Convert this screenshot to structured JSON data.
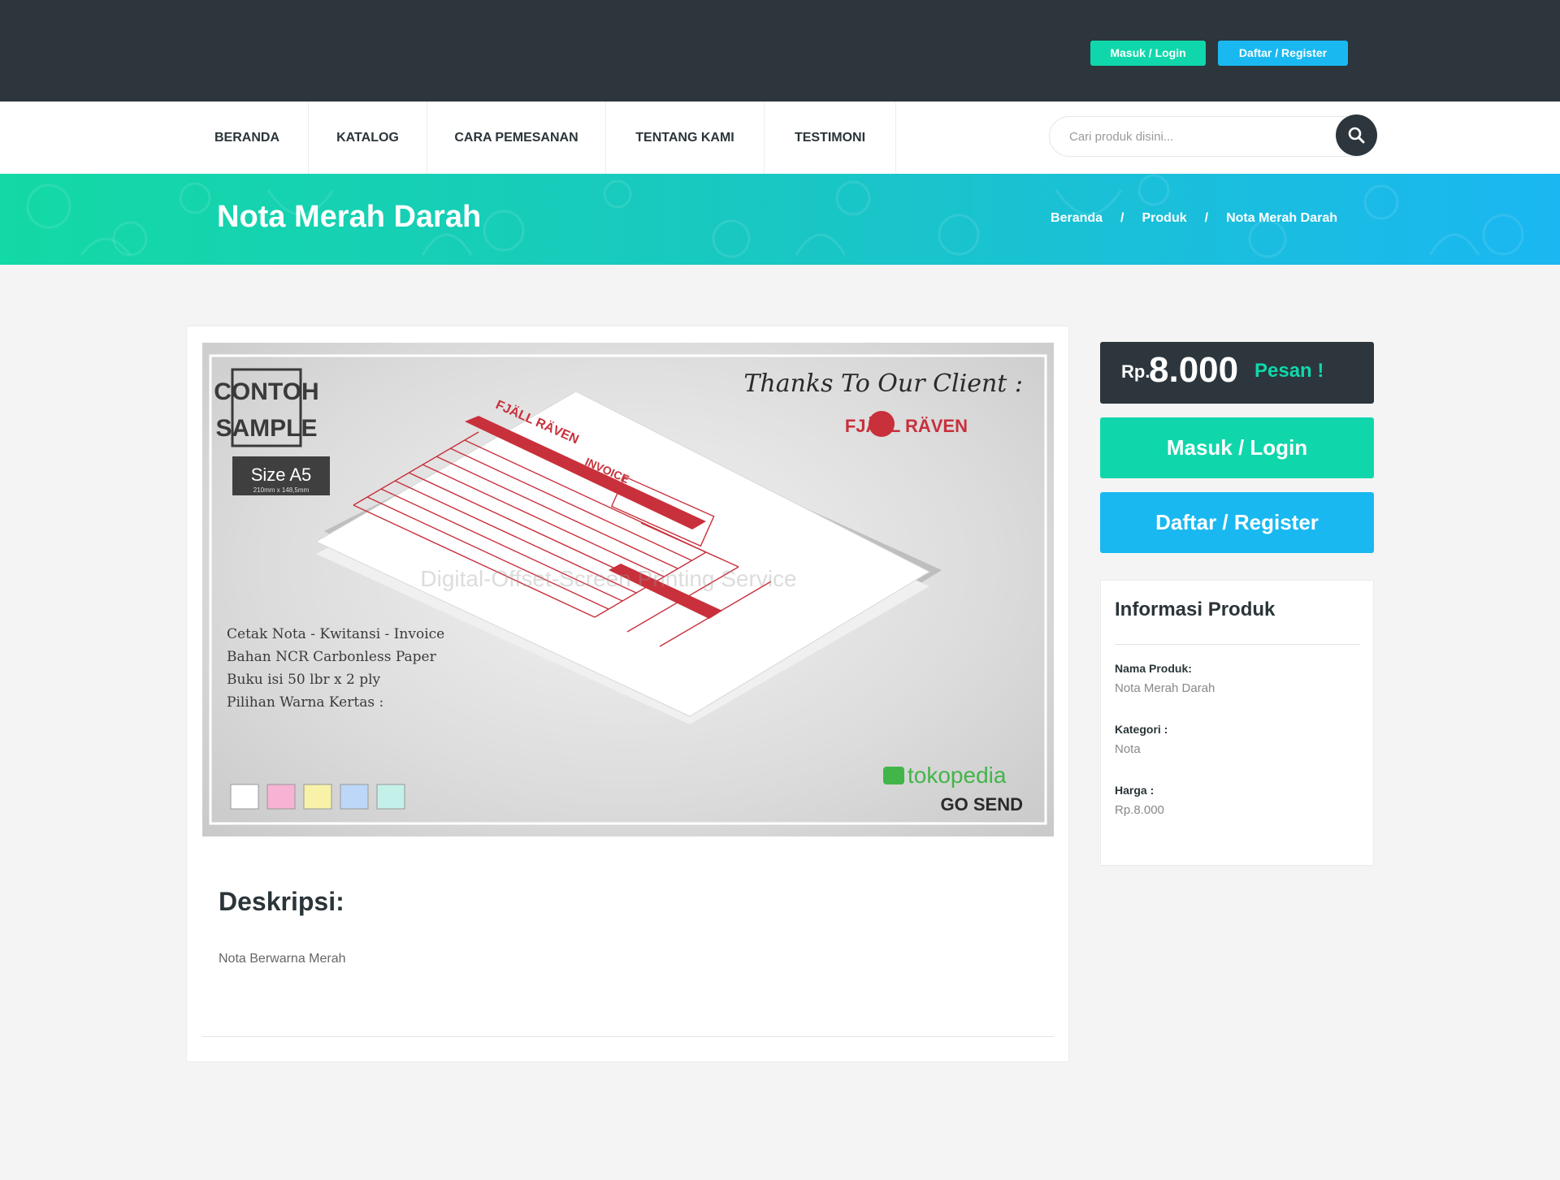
{
  "topbar": {
    "login_label": "Masuk / Login",
    "register_label": "Daftar / Register"
  },
  "nav": {
    "items": [
      {
        "label": "BERANDA"
      },
      {
        "label": "KATALOG"
      },
      {
        "label": "CARA PEMESANAN"
      },
      {
        "label": "TENTANG KAMI"
      },
      {
        "label": "TESTIMONI"
      }
    ],
    "search_placeholder": "Cari produk disini...",
    "search_icon": "search-icon"
  },
  "hero": {
    "title": "Nota Merah Darah",
    "breadcrumb": [
      "Beranda",
      "Produk",
      "Nota Merah Darah"
    ],
    "breadcrumb_separator": "/"
  },
  "product_image": {
    "contoh": "CONTOH",
    "sample": "SAMPLE",
    "size": "Size A5",
    "size_detail": "210mm x 148,5mm",
    "thanks": "Thanks To Our Client :",
    "client": "FJÄLL RÄVEN",
    "invoice": "INVOICE",
    "features": [
      "Cetak Nota - Kwitansi - Invoice",
      "Bahan NCR Carbonless Paper",
      "Buku isi 50 lbr x 2 ply",
      "Pilihan Warna Kertas :"
    ],
    "paper_colors": [
      "#ffffff",
      "#f6b3d3",
      "#f8f2a8",
      "#bcd7f7",
      "#c4f0ea"
    ],
    "watermark_sub": "Digital-Offset-Screen Printing Service",
    "tokopedia": "tokopedia",
    "gosend": "GO SEND"
  },
  "description": {
    "title": "Deskripsi:",
    "text": "Nota Berwarna Merah"
  },
  "price": {
    "currency": "Rp.",
    "value": "8.000",
    "order_label": "Pesan !"
  },
  "sidebar": {
    "login_label": "Masuk / Login",
    "register_label": "Daftar / Register"
  },
  "info": {
    "title": "Informasi Produk",
    "name_label": "Nama Produk:",
    "name_value": "Nota Merah Darah",
    "category_label": "Kategori :",
    "category_value": "Nota",
    "price_label": "Harga :",
    "price_value": "Rp.8.000"
  },
  "colors": {
    "dark": "#2c363c",
    "teal": "#10d7ab",
    "blue": "#19b8f1",
    "invoice_red": "#c8303b"
  }
}
